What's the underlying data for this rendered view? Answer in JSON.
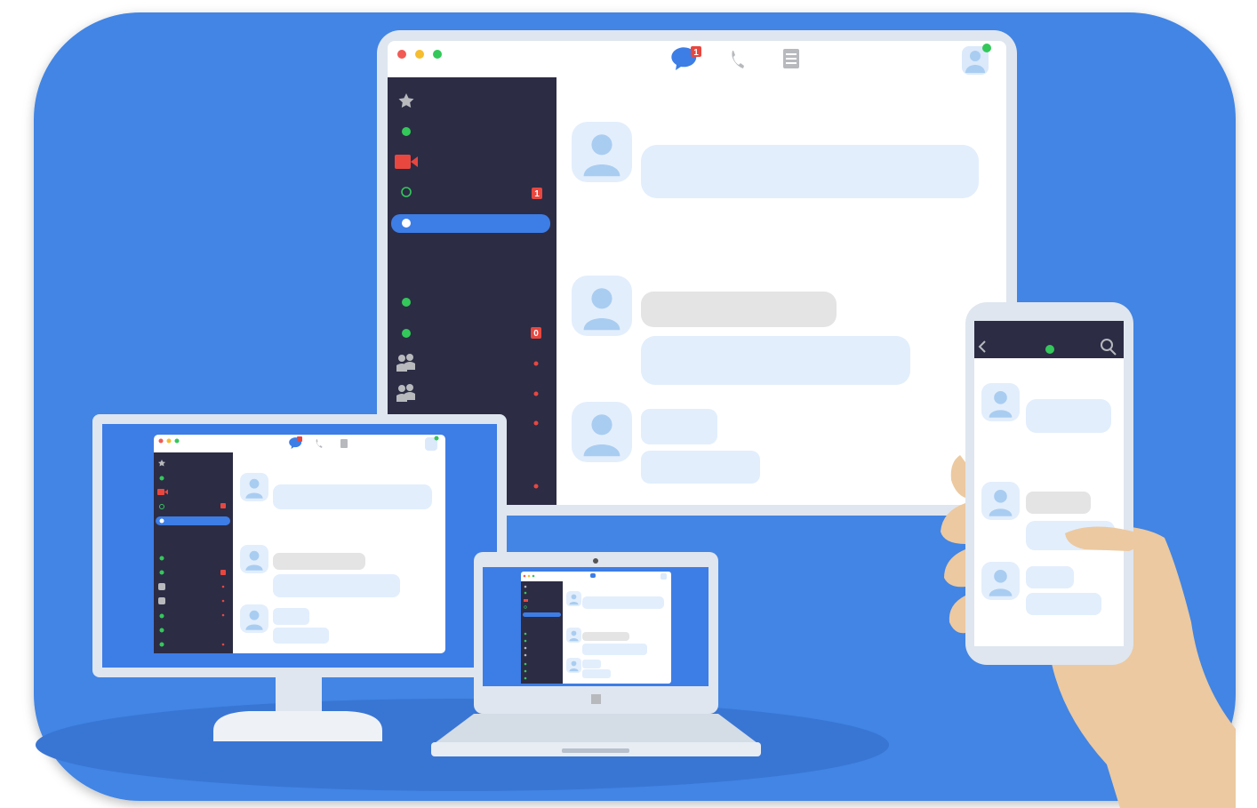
{
  "tablet": {
    "header": {
      "traffic_lights": [
        "close",
        "minimize",
        "maximize"
      ],
      "icons": [
        "chat-bubble-icon",
        "phone-icon",
        "document-icon",
        "user-avatar-icon"
      ],
      "chat_badge": "1"
    },
    "sidebar": {
      "items": [
        {
          "icon": "star-icon",
          "badge": ""
        },
        {
          "icon": "green-status-dot",
          "badge": ""
        },
        {
          "icon": "video-camera-icon",
          "badge": ""
        },
        {
          "icon": "hollow-status-ring",
          "badge": "1"
        },
        {
          "icon": "white-status-dot",
          "badge": "",
          "selected": true
        },
        {
          "icon": "green-status-dot",
          "badge": ""
        },
        {
          "icon": "green-status-dot",
          "badge": "0"
        },
        {
          "icon": "group-icon",
          "badge": ""
        },
        {
          "icon": "group-icon",
          "badge": ""
        }
      ]
    }
  },
  "monitor": {
    "chat_badge": "1"
  },
  "colors": {
    "background": "#4285e4",
    "sidebar": "#2c2c45",
    "accent": "#3d7de6",
    "badge": "#e8473f",
    "status_green": "#34c85a",
    "bubble": "#e2eefc",
    "bubble_gray": "#e4e4e4",
    "skin": "#ecc9a0"
  }
}
